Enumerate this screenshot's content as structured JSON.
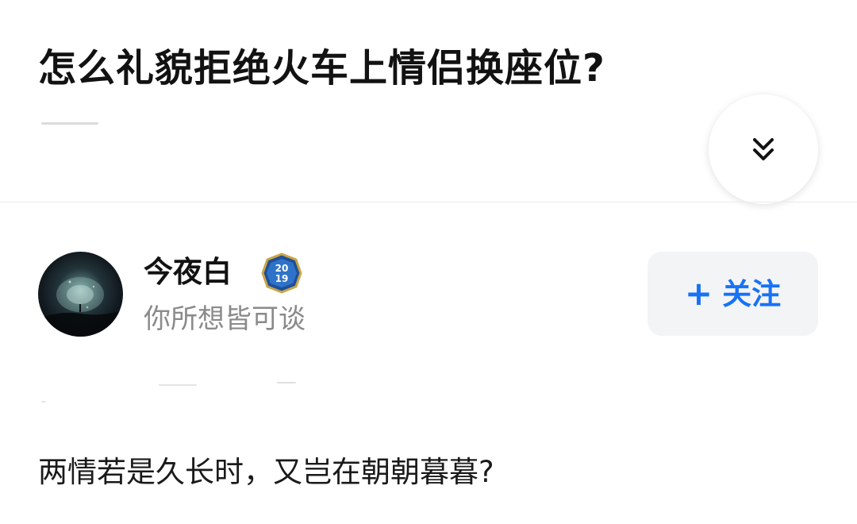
{
  "question": {
    "title": "怎么礼貌拒绝火车上情侣换座位?"
  },
  "expand_button": {
    "icon": "double-chevron-down-icon",
    "color": "#121212"
  },
  "author": {
    "name": "今夜白",
    "badge_text": "20\n19",
    "badge_year": "2019",
    "bio": "你所想皆可谈"
  },
  "follow_button": {
    "plus": "+",
    "label": "关注",
    "accent_color": "#1772f6",
    "background": "#f3f4f6"
  },
  "answer": {
    "text": "两情若是久长时，又岂在朝朝暮暮?"
  }
}
